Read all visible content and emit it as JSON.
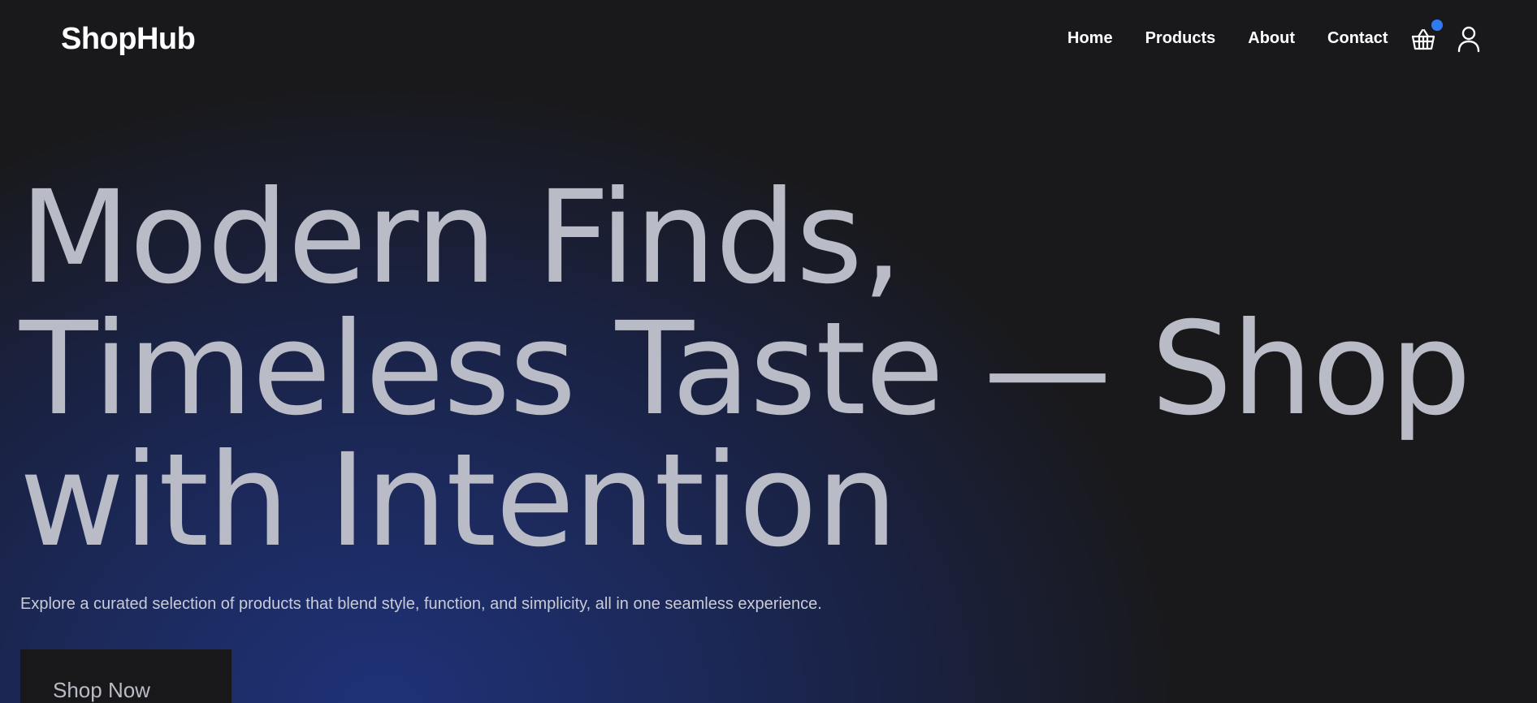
{
  "brand": {
    "name": "ShopHub"
  },
  "nav": {
    "links": [
      {
        "label": "Home"
      },
      {
        "label": "Products"
      },
      {
        "label": "About"
      },
      {
        "label": "Contact"
      }
    ],
    "cart_icon": "basket-icon",
    "cart_badge_color": "#2f7bf1",
    "account_icon": "user-icon"
  },
  "hero": {
    "headline": "Modern Finds, Timeless Taste — Shop with Intention",
    "subtitle": "Explore a curated selection of products that blend style, function, and simplicity, all in one seamless experience.",
    "cta_label": "Shop Now"
  },
  "colors": {
    "background": "#19191c",
    "gradient_accent": "#1f3278",
    "headline_text": "#b9bbc6",
    "nav_text": "#ffffff"
  }
}
